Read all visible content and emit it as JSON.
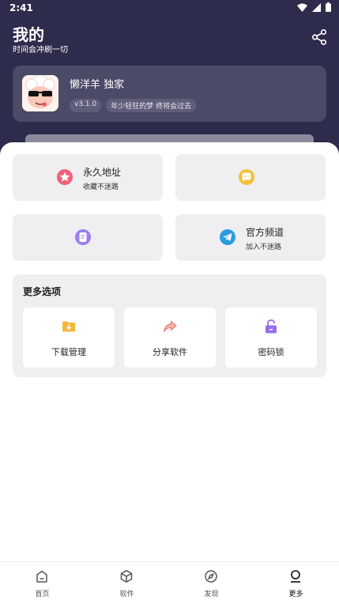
{
  "status_bar": {
    "time": "2:41",
    "icons": [
      "wifi-icon",
      "signal-icon",
      "battery-icon"
    ]
  },
  "header": {
    "title": "我的",
    "subtitle": "时间会冲刷一切",
    "share_icon": "share-icon"
  },
  "profile": {
    "name": "懒洋羊 独家",
    "version": "v3.1.0",
    "motto": "年少轻狂的梦 终将会过去"
  },
  "tiles": [
    {
      "title": "永久地址",
      "subtitle": "收藏不迷路",
      "icon": "star-icon",
      "color": "#f0607a"
    },
    {
      "title": "",
      "subtitle": "",
      "icon": "chat-bubble-icon",
      "color": "#f2c03a"
    },
    {
      "title": "",
      "subtitle": "",
      "icon": "document-icon",
      "color": "#9c7cf0"
    },
    {
      "title": "官方频道",
      "subtitle": "加入不迷路",
      "icon": "telegram-icon",
      "color": "#2b9be0"
    }
  ],
  "more": {
    "title": "更多选项",
    "options": [
      {
        "label": "下载管理",
        "icon": "download-folder-icon",
        "color": "#f5b73b"
      },
      {
        "label": "分享软件",
        "icon": "share-arrow-icon",
        "color": "#e98e7a"
      },
      {
        "label": "密码锁",
        "icon": "lock-icon",
        "color": "#9b6cf0"
      }
    ]
  },
  "nav": {
    "items": [
      {
        "label": "首页",
        "icon": "home-icon"
      },
      {
        "label": "软件",
        "icon": "box-icon"
      },
      {
        "label": "发现",
        "icon": "compass-icon"
      },
      {
        "label": "更多",
        "icon": "person-icon"
      }
    ],
    "active": "更多"
  }
}
